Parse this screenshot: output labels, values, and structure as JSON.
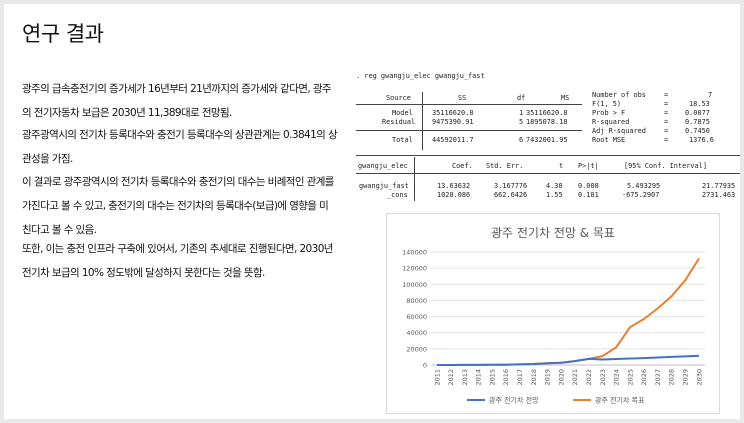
{
  "slide": {
    "title": "연구 결과",
    "paragraphs": [
      [
        "광주의 급속충전기의 증가세가 16년부터 21년까지의 증가세와 같다면, 광주",
        "의 전기자동차 보급은 2030년 11,389대로 전망됨."
      ],
      [
        "광주광역시의 전기차 등록대수와 충전기 등록대수의 상관관계는 0.3841의 상",
        "관성을 가짐."
      ],
      [
        "이 결과로 광주광역시의 전기차 등록대수와 충전기의 대수는 비례적인 관계를",
        "가진다고 볼 수 있고, 충전기의 대수는 전기차의 등록대수(보급)에 영향을 미",
        "친다고 볼 수 있음."
      ],
      [
        "또한, 이는 충전 인프라 구축에 있어서, 기존의 추세대로 진행된다면, 2030년",
        "전기차 보급의 10% 정도밖에 달성하지 못한다는 것을 뜻함."
      ]
    ]
  },
  "stata": {
    "command": ". reg gwangju_elec gwangju_fast",
    "anova_header": {
      "source": "Source",
      "ss": "SS",
      "df": "df",
      "ms": "MS"
    },
    "anova_rows": [
      {
        "source": "Model",
        "ss": "35116620.8",
        "df": "1",
        "ms": "35116620.8"
      },
      {
        "source": "Residual",
        "ss": "9475390.91",
        "df": "5",
        "ms": "1895078.18"
      },
      {
        "source": "Total",
        "ss": "44592011.7",
        "df": "6",
        "ms": "7432001.95"
      }
    ],
    "fit_stats": [
      {
        "label": "Number of obs",
        "eq": "=",
        "value": "7"
      },
      {
        "label": "F(1, 5)",
        "eq": "=",
        "value": "18.53"
      },
      {
        "label": "Prob > F",
        "eq": "=",
        "value": "0.0077"
      },
      {
        "label": "R-squared",
        "eq": "=",
        "value": "0.7875"
      },
      {
        "label": "Adj R-squared",
        "eq": "=",
        "value": "0.7450"
      },
      {
        "label": "Root MSE",
        "eq": "=",
        "value": "1376.6"
      }
    ],
    "coef_header": {
      "var": "gwangju_elec",
      "coef": "Coef.",
      "se": "Std. Err.",
      "t": "t",
      "p": "P>|t|",
      "ci": "[95% Conf. Interval]"
    },
    "coef_rows": [
      {
        "var": "gwangju_fast",
        "coef": "13.63632",
        "se": "3.167776",
        "t": "4.30",
        "p": "0.008",
        "lo": "5.493295",
        "hi": "21.77935"
      },
      {
        "var": "_cons",
        "coef": "1028.086",
        "se": "662.6426",
        "t": "1.55",
        "p": "0.181",
        "lo": "-675.2907",
        "hi": "2731.463"
      }
    ]
  },
  "chart_data": {
    "type": "line",
    "title": "광주 전기차 전망 & 목표",
    "x": [
      "2011",
      "2012",
      "2013",
      "2014",
      "2015",
      "2016",
      "2017",
      "2018",
      "2019",
      "2020",
      "2021",
      "2022",
      "2023",
      "2024",
      "2025",
      "2026",
      "2027",
      "2028",
      "2029",
      "2030"
    ],
    "ylim": [
      0,
      140000
    ],
    "yticks": [
      0,
      20000,
      40000,
      60000,
      80000,
      100000,
      120000,
      140000
    ],
    "grid": true,
    "legend_position": "bottom",
    "series": [
      {
        "name": "광주 전기차 전망",
        "color": "#4472c4",
        "values": [
          20,
          50,
          100,
          150,
          250,
          400,
          700,
          1300,
          2200,
          2900,
          4800,
          7600,
          6800,
          7400,
          8000,
          8600,
          9300,
          10000,
          10700,
          11389
        ]
      },
      {
        "name": "광주 전기차 목표",
        "color": "#ed7d31",
        "values": [
          20,
          50,
          100,
          150,
          250,
          400,
          700,
          1300,
          2200,
          2900,
          4800,
          7600,
          11000,
          22000,
          47000,
          57000,
          70000,
          85000,
          105000,
          132000
        ]
      }
    ]
  }
}
